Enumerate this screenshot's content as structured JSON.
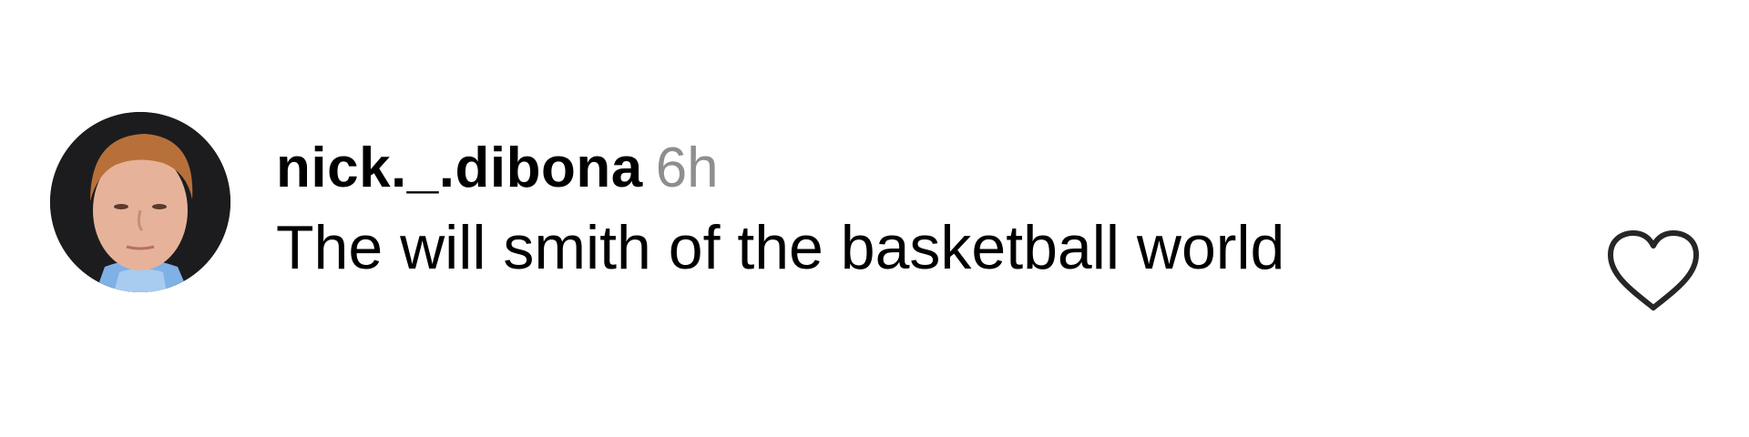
{
  "comment": {
    "username": "nick._.dibona",
    "timestamp": "6h",
    "text": "The will smith of the basketball world",
    "avatar_icon": "user-photo-avatar",
    "like_icon": "heart-outline-icon",
    "colors": {
      "username": "#000000",
      "timestamp": "#8e8e8e",
      "text": "#000000",
      "heart_stroke": "#262626"
    }
  }
}
